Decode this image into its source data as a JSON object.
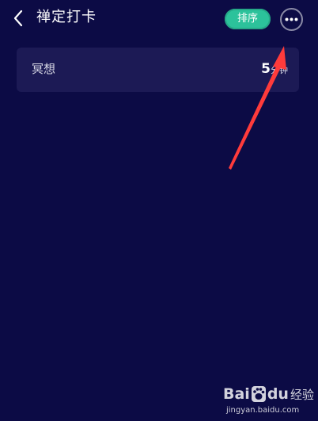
{
  "header": {
    "title": "禅定打卡",
    "sort_label": "排序",
    "back_icon": "chevron-left-icon",
    "more_icon": "more-horizontal-icon"
  },
  "card": {
    "label": "冥想",
    "value": "5",
    "unit": "分钟"
  },
  "watermark": {
    "brand_left": "Bai",
    "brand_right": "du",
    "brand_suffix": "经验",
    "url": "jingyan.baidu.com"
  },
  "colors": {
    "background": "#0c0b45",
    "card": "#1c1a55",
    "accent": "#2cc29b",
    "annotation_arrow": "#ff3b3b"
  }
}
